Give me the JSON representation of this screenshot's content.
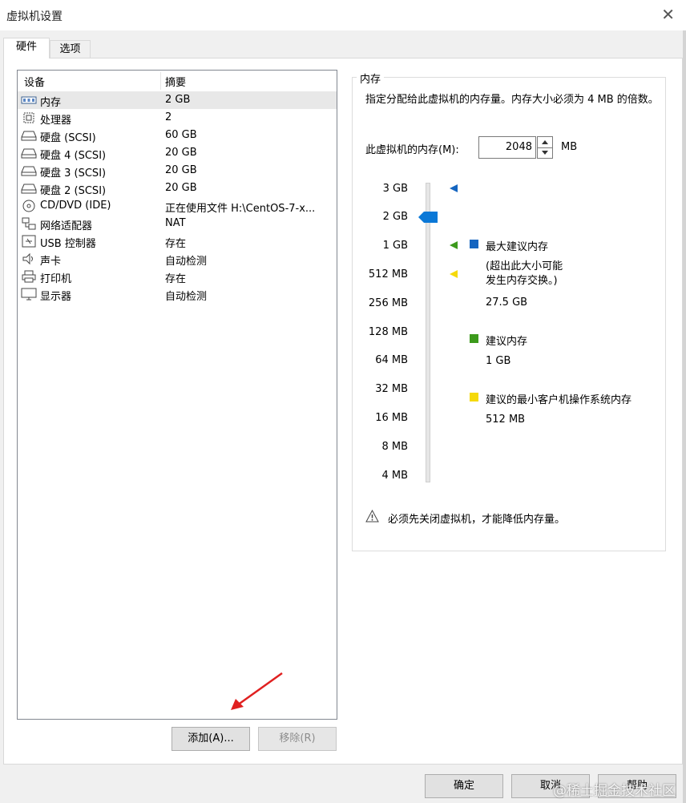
{
  "window": {
    "title": "虚拟机设置"
  },
  "tabs": [
    {
      "label": "硬件",
      "active": true
    },
    {
      "label": "选项",
      "active": false
    }
  ],
  "device_list": {
    "columns": [
      "设备",
      "摘要"
    ],
    "rows": [
      {
        "icon": "memory-icon",
        "name": "内存",
        "summary": "2 GB",
        "selected": true
      },
      {
        "icon": "cpu-icon",
        "name": "处理器",
        "summary": "2"
      },
      {
        "icon": "disk-icon",
        "name": "硬盘 (SCSI)",
        "summary": "60 GB"
      },
      {
        "icon": "disk-icon",
        "name": "硬盘 4 (SCSI)",
        "summary": "20 GB"
      },
      {
        "icon": "disk-icon",
        "name": "硬盘 3 (SCSI)",
        "summary": "20 GB"
      },
      {
        "icon": "disk-icon",
        "name": "硬盘 2 (SCSI)",
        "summary": "20 GB"
      },
      {
        "icon": "cd-icon",
        "name": "CD/DVD (IDE)",
        "summary": "正在使用文件 H:\\CentOS-7-x..."
      },
      {
        "icon": "network-icon",
        "name": "网络适配器",
        "summary": "NAT"
      },
      {
        "icon": "usb-icon",
        "name": "USB 控制器",
        "summary": "存在"
      },
      {
        "icon": "speaker-icon",
        "name": "声卡",
        "summary": "自动检测"
      },
      {
        "icon": "printer-icon",
        "name": "打印机",
        "summary": "存在"
      },
      {
        "icon": "monitor-icon",
        "name": "显示器",
        "summary": "自动检测"
      }
    ]
  },
  "list_buttons": {
    "add": "添加(A)...",
    "remove": "移除(R)"
  },
  "memory": {
    "group_title": "内存",
    "description": "指定分配给此虚拟机的内存量。内存大小必须为 4 MB 的倍数。",
    "field_label": "此虚拟机的内存(M):",
    "value": "2048",
    "unit": "MB",
    "scale_ticks": [
      "3 GB",
      "2 GB",
      "1 GB",
      "512 MB",
      "256 MB",
      "128 MB",
      "64 MB",
      "32 MB",
      "16 MB",
      "8 MB",
      "4 MB"
    ],
    "legend": {
      "max": {
        "label": "最大建议内存",
        "note": "(超出此大小可能\n发生内存交换。)",
        "value": "27.5 GB",
        "color": "#1565c0"
      },
      "recommended": {
        "label": "建议内存",
        "value": "1 GB",
        "color": "#3c9a1c"
      },
      "min": {
        "label": "建议的最小客户机操作系统内存",
        "value": "512 MB",
        "color": "#f5d90a"
      }
    },
    "warning": "必须先关闭虚拟机，才能降低内存量。",
    "slider_color": "#0a78d7"
  },
  "dialog_buttons": {
    "ok": "确定",
    "cancel": "取消",
    "help": "帮助"
  },
  "watermark": "@稀土掘金技术社区"
}
